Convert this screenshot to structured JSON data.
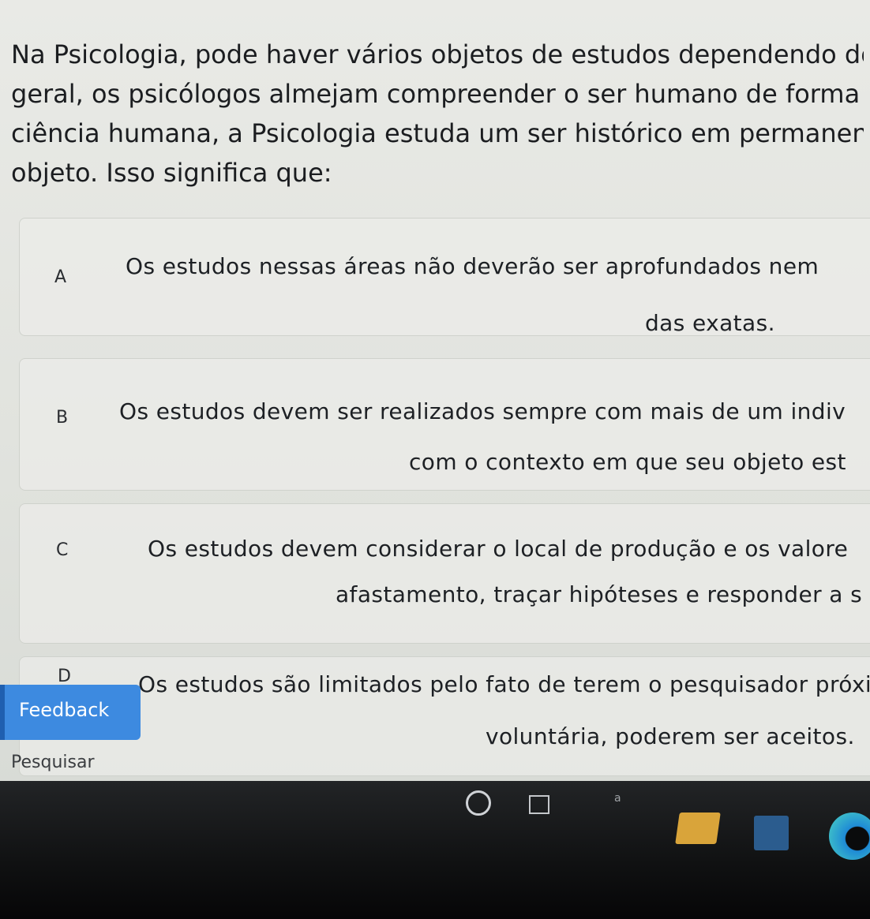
{
  "question": {
    "lines": [
      "Na Psicologia, pode haver vários objetos de estudos dependendo do",
      "geral, os psicólogos almejam compreender o ser humano de forma ar",
      "ciência humana, a Psicologia estuda um ser histórico em permanente",
      "objeto. Isso significa que:"
    ]
  },
  "options": [
    {
      "letter": "A",
      "lines": [
        "Os estudos nessas áreas não deverão ser aprofundados nem",
        "das exatas."
      ]
    },
    {
      "letter": "B",
      "lines": [
        "Os estudos devem ser realizados sempre com mais de um indiv",
        "com o contexto em que seu objeto est"
      ]
    },
    {
      "letter": "C",
      "lines": [
        "Os estudos devem considerar o local de produção e os valore",
        "afastamento, traçar hipóteses e responder a s"
      ]
    },
    {
      "letter": "D",
      "lines": [
        "Os estudos são limitados pelo fato de terem o pesquisador próxin",
        "voluntária, poderem ser aceitos."
      ]
    }
  ],
  "feedback_label": "Feedback",
  "search_label": "Pesquisar",
  "taskbar": {
    "icons": [
      "search-ring-icon",
      "task-view-icon",
      "widget-icon",
      "file-explorer-icon",
      "store-icon",
      "edge-icon"
    ],
    "small_text": "a"
  }
}
